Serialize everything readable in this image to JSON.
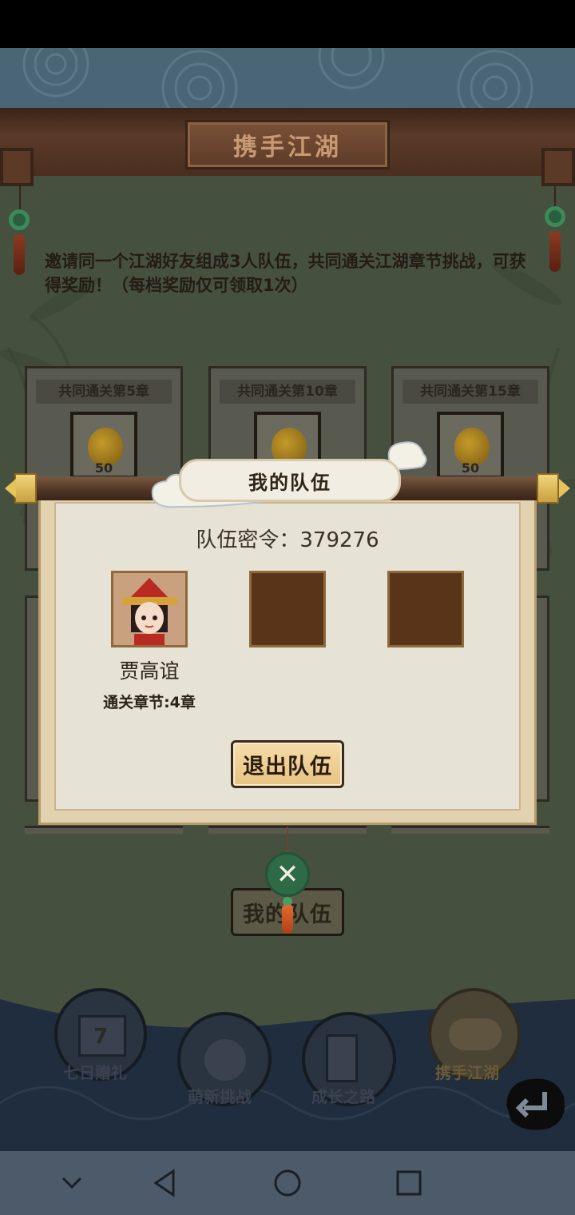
{
  "header": {
    "title": "携手江湖"
  },
  "intro": {
    "text": "邀请同一个江湖好友组成3人队伍，共同通关江湖章节挑战，可获得奖励！（每档奖励仅可领取1次）"
  },
  "rewards": [
    {
      "title": "共同通关第5章",
      "item_icon": "gourd-icon",
      "count": "50"
    },
    {
      "title": "共同通关第10章",
      "item_icon": "gourd-icon",
      "count": ""
    },
    {
      "title": "共同通关第15章",
      "item_icon": "gourd-icon",
      "count": "50"
    }
  ],
  "modal": {
    "title": "我的队伍",
    "team_code_label": "队伍密令：",
    "team_code": "379276",
    "team_code_full": "队伍密令：379276",
    "members": [
      {
        "name": "贾高谊",
        "chapter": "通关章节:4章",
        "avatar_icon": "character-avatar-icon"
      },
      {
        "empty": true
      },
      {
        "empty": true
      }
    ],
    "leave_button": "退出队伍",
    "close_icon": "close-x-icon"
  },
  "background_button": {
    "label": "我的队伍"
  },
  "bottom_nav": [
    {
      "label": "七日赠礼",
      "icon": "gift-box-icon",
      "badge": "7",
      "active": false
    },
    {
      "label": "萌新挑战",
      "icon": "cute-face-icon",
      "active": false
    },
    {
      "label": "成长之路",
      "icon": "book-arrow-icon",
      "active": false
    },
    {
      "label": "携手江湖",
      "icon": "handshake-icon",
      "active": true
    }
  ],
  "back_icon": "return-arrow-icon",
  "system_nav": [
    "chevron-down-icon",
    "back-triangle-icon",
    "home-circle-icon",
    "recents-square-icon"
  ],
  "colors": {
    "accent_green": "#2e6a46",
    "button_gold": "#e7c283",
    "slot_brown": "#5a3418"
  }
}
